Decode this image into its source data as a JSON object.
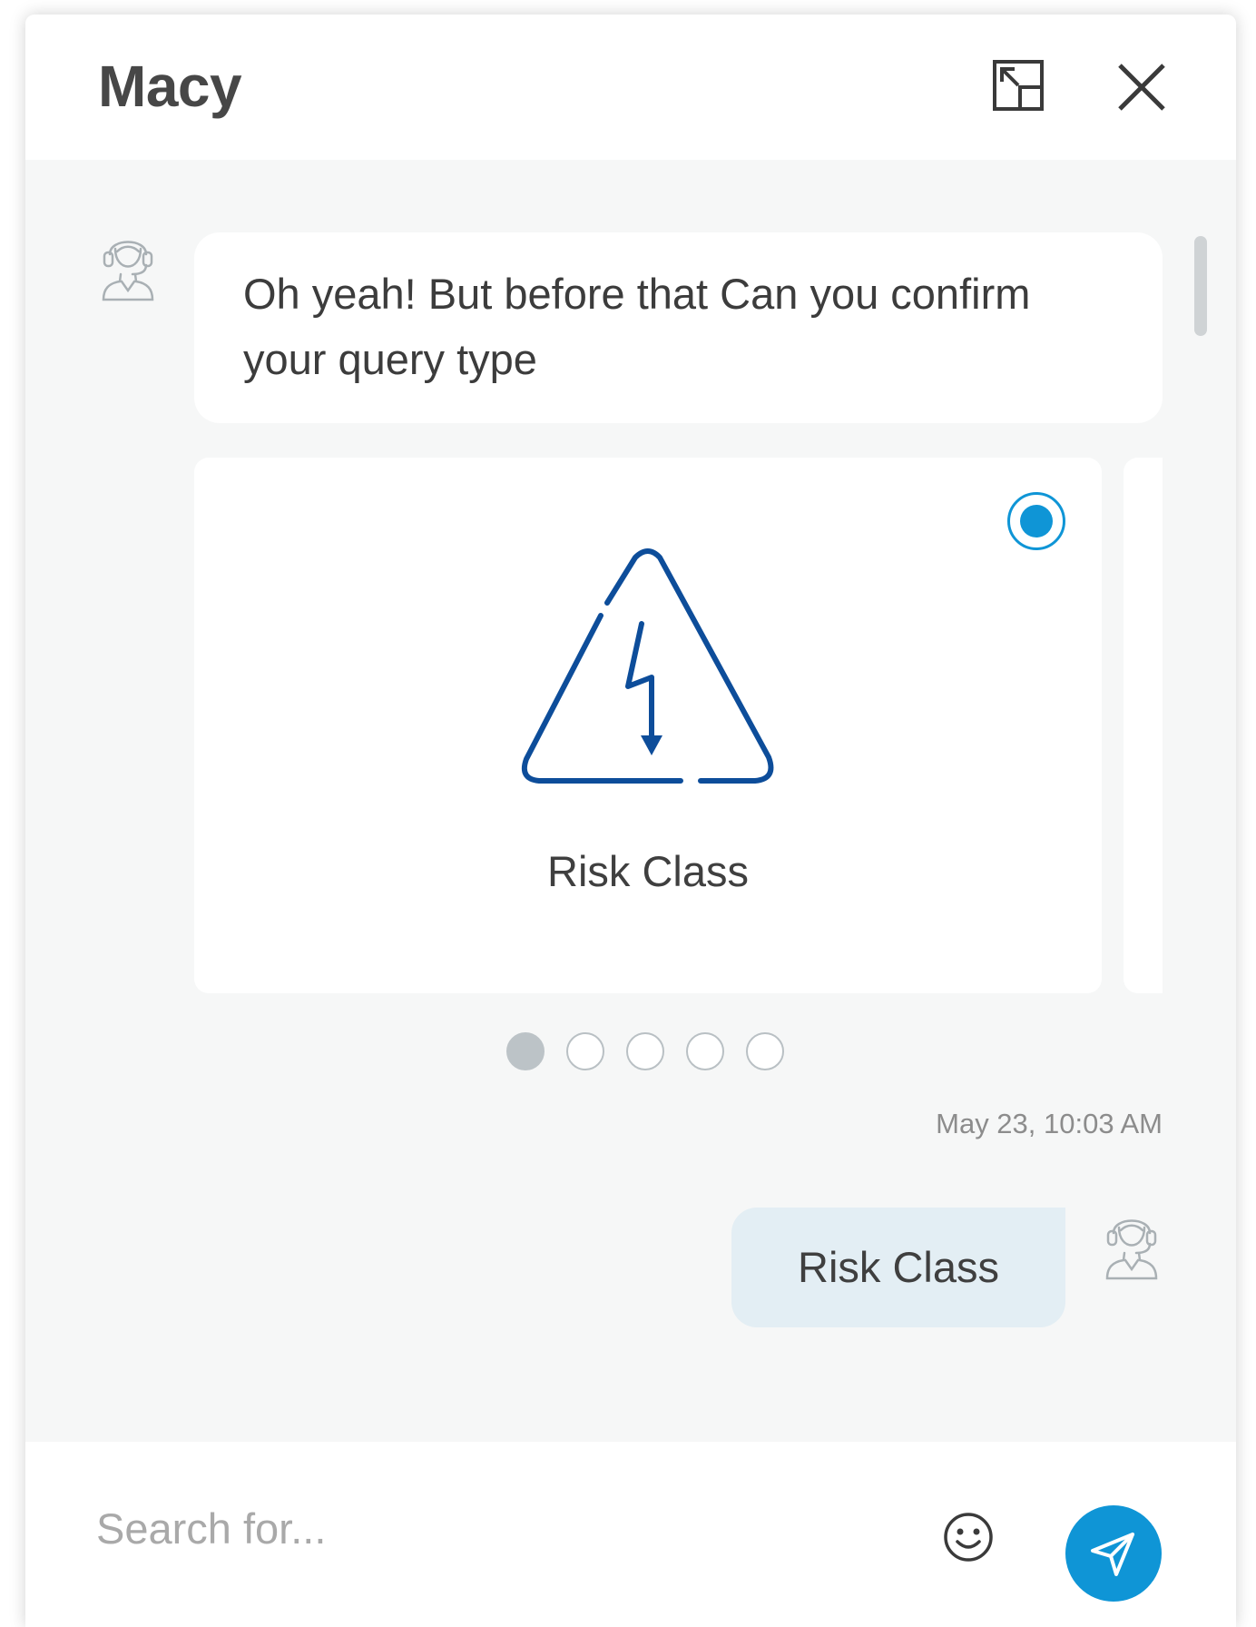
{
  "header": {
    "title": "Macy"
  },
  "messages": {
    "bot_text": "Oh yeah!  But before that Can you confirm your query type",
    "timestamp": "May 23, 10:03 AM",
    "user_reply": "Risk Class"
  },
  "carousel": {
    "card_label": "Risk Class",
    "card_icon": "high-voltage-warning-icon",
    "selected": true,
    "page_count": 5,
    "active_page": 1
  },
  "footer": {
    "search_placeholder": "Search for..."
  },
  "colors": {
    "accent": "#0f95d6",
    "icon_blue": "#0d4d9a",
    "outgoing_bubble": "#e3eef4",
    "chat_background": "#f6f7f7"
  }
}
